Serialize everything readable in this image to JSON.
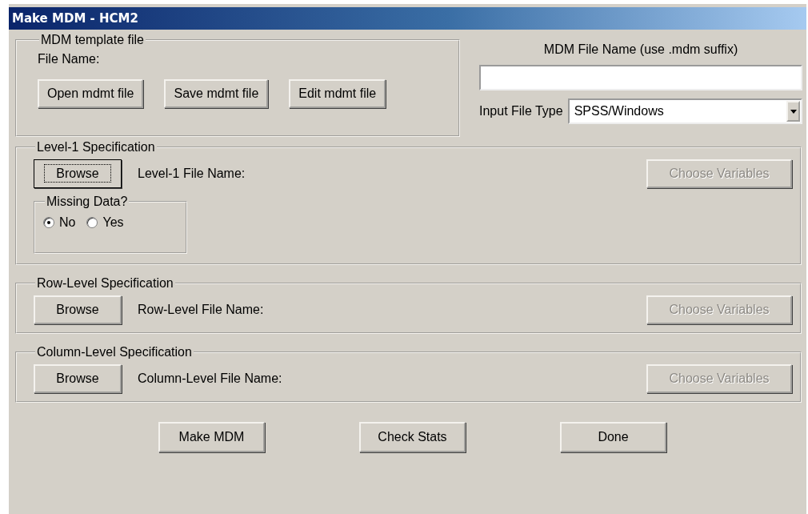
{
  "window": {
    "title": "Make MDM - HCM2"
  },
  "template": {
    "legend": "MDM template file",
    "file_label": "File Name:",
    "buttons": [
      "Open mdmt file",
      "Save mdmt file",
      "Edit mdmt file"
    ]
  },
  "mdm_file": {
    "label": "MDM File Name (use .mdm suffix)"
  },
  "input_type": {
    "label": "Input File Type",
    "value": "SPSS/Windows"
  },
  "sections": [
    {
      "legend": "Level-1 Specification",
      "browse": {
        "label": "Browse",
        "focused": true
      },
      "file_label": "Level-1 File Name:",
      "choose": {
        "label": "Choose Variables",
        "disabled": true
      },
      "missing_data": {
        "legend": "Missing Data?",
        "options": [
          {
            "label": "No",
            "selected": true
          },
          {
            "label": "Yes",
            "selected": false
          }
        ]
      }
    },
    {
      "legend": "Row-Level Specification",
      "browse": {
        "label": "Browse",
        "focused": false
      },
      "file_label": "Row-Level File Name:",
      "choose": {
        "label": "Choose Variables",
        "disabled": true
      }
    },
    {
      "legend": "Column-Level Specification",
      "browse": {
        "label": "Browse",
        "focused": false
      },
      "file_label": "Column-Level File Name:",
      "choose": {
        "label": "Choose Variables",
        "disabled": true
      }
    }
  ],
  "footer_buttons": [
    "Make MDM",
    "Check Stats",
    "Done"
  ]
}
